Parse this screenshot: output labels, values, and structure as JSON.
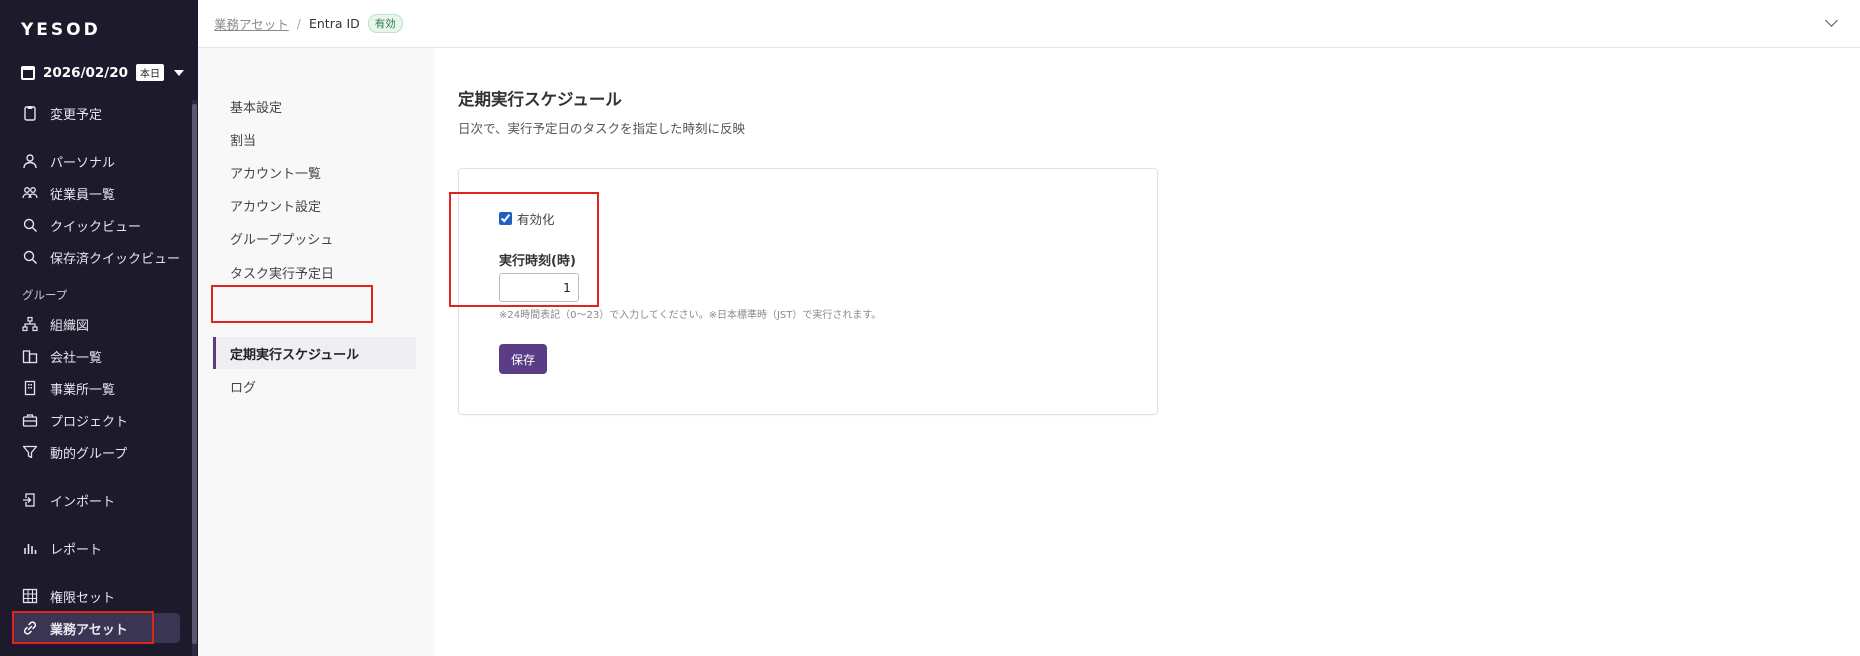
{
  "app": {
    "logo": "YESOD",
    "date": "2026/02/20",
    "today_badge": "本日"
  },
  "sidebar": {
    "items": [
      {
        "label": "変更予定",
        "icon": "clipboard-icon"
      },
      {
        "label": "パーソナル",
        "icon": "person-icon"
      },
      {
        "label": "従業員一覧",
        "icon": "people-icon"
      },
      {
        "label": "クイックビュー",
        "icon": "search-icon"
      },
      {
        "label": "保存済クイックビュー",
        "icon": "search-icon"
      },
      {
        "label": "組織図",
        "icon": "org-chart-icon"
      },
      {
        "label": "会社一覧",
        "icon": "building-icon"
      },
      {
        "label": "事業所一覧",
        "icon": "office-icon"
      },
      {
        "label": "プロジェクト",
        "icon": "briefcase-icon"
      },
      {
        "label": "動的グループ",
        "icon": "filter-icon"
      },
      {
        "label": "インポート",
        "icon": "import-icon"
      },
      {
        "label": "レポート",
        "icon": "chart-icon"
      },
      {
        "label": "権限セット",
        "icon": "grid-icon"
      },
      {
        "label": "業務アセット",
        "icon": "link-icon",
        "active": true
      }
    ],
    "group_section": "グループ"
  },
  "breadcrumb": {
    "parent": "業務アセット",
    "separator": "/",
    "current": "Entra ID",
    "status": "有効"
  },
  "subnav": {
    "items": [
      "基本設定",
      "割当",
      "アカウント一覧",
      "アカウント設定",
      "グループプッシュ",
      "タスク実行予定日",
      "定期実行スケジュール",
      "ログ"
    ],
    "active_index": 6
  },
  "main": {
    "title": "定期実行スケジュール",
    "description": "日次で、実行予定日のタスクを指定した時刻に反映",
    "enable_label": "有効化",
    "enabled": true,
    "time_label": "実行時刻(時)",
    "time_value": "1",
    "hint": "※24時間表記（0～23）で入力してください。※日本標準時（JST）で実行されます。",
    "save_label": "保存"
  },
  "colors": {
    "sidebar_bg": "#1d1a2b",
    "accent": "#5b3d86",
    "highlight": "#e0231c",
    "badge_green": "#2a7a46"
  }
}
